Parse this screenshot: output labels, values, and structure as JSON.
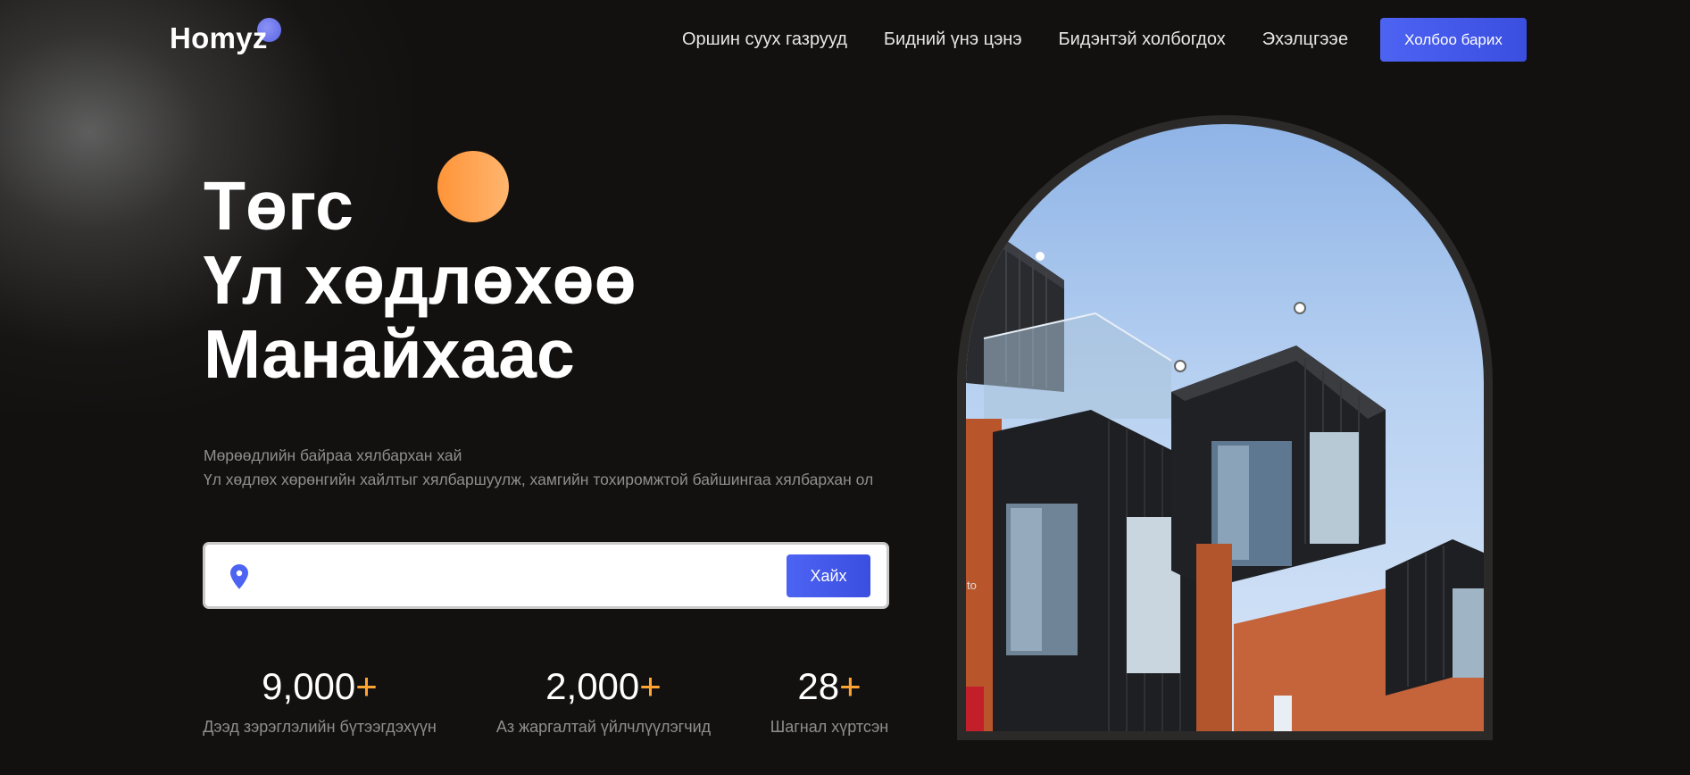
{
  "header": {
    "logo_text": "Homyz",
    "nav": [
      {
        "label": "Оршин суух газрууд"
      },
      {
        "label": "Бидний үнэ цэнэ"
      },
      {
        "label": "Бидэнтэй холбогдох"
      },
      {
        "label": "Эхэлцгээе"
      }
    ],
    "contact_button": "Холбоо барих"
  },
  "hero": {
    "title_lines": [
      "Төгс",
      "Үл хөдлөхөө",
      "Манайхаас"
    ],
    "subtitle_lines": [
      "Мөрөөдлийн байраа хялбархан хай",
      "Үл хөдлөх хөрөнгийн хайлтыг хялбаршуулж, хамгийн тохиромжтой байшингаа хялбархан ол"
    ]
  },
  "search": {
    "value": "",
    "placeholder": "",
    "button_label": "Хайх",
    "icon": "location-pin-icon"
  },
  "stats": [
    {
      "value": "9,000",
      "suffix": "+",
      "label": "Дээд зэрэглэлийн бүтээгдэхүүн"
    },
    {
      "value": "2,000",
      "suffix": "+",
      "label": "Аз жаргалтай үйлчлүүлэгчид"
    },
    {
      "value": "28",
      "suffix": "+",
      "label": "Шагнал хүртсэн"
    }
  ],
  "image": {
    "caption": "to"
  },
  "colors": {
    "background": "#131110",
    "accent_blue": "#4d63f2",
    "accent_orange": "#ffa433",
    "muted_text": "#8e8e8e"
  }
}
